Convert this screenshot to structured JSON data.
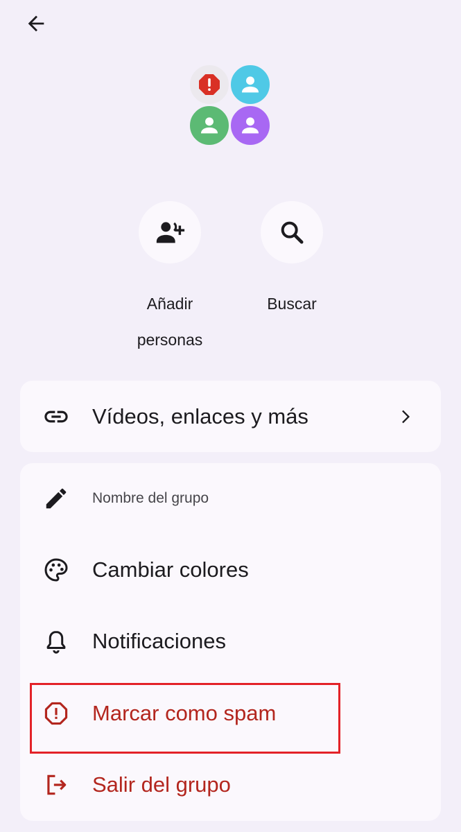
{
  "header": {
    "back_icon": "arrow-back-icon"
  },
  "avatars": [
    {
      "role": "spam-warning",
      "color": "#d93025",
      "icon": "error-octagon-icon"
    },
    {
      "role": "member",
      "color": "#4fc9e6",
      "icon": "person-icon"
    },
    {
      "role": "member",
      "color": "#5cba74",
      "icon": "person-icon"
    },
    {
      "role": "member",
      "color": "#a868f3",
      "icon": "person-icon"
    }
  ],
  "actions": {
    "add_people": {
      "label_line1": "Añadir",
      "label_line2": "personas",
      "icon": "person-add-icon"
    },
    "search": {
      "label": "Buscar",
      "icon": "search-icon"
    }
  },
  "media_row": {
    "label": "Vídeos, enlaces y más",
    "icon": "link-icon",
    "chevron": "chevron-right-icon"
  },
  "settings": {
    "group_name": {
      "label": "Nombre del grupo",
      "icon": "pencil-icon"
    },
    "colors": {
      "label": "Cambiar colores",
      "icon": "palette-icon"
    },
    "notifications": {
      "label": "Notificaciones",
      "icon": "bell-icon"
    },
    "spam": {
      "label": "Marcar como spam",
      "icon": "report-icon"
    },
    "leave": {
      "label": "Salir del grupo",
      "icon": "logout-icon"
    }
  },
  "colors": {
    "background": "#f3eff9",
    "card": "#fbf8fd",
    "danger": "#b3261e",
    "highlight": "#e32228"
  }
}
